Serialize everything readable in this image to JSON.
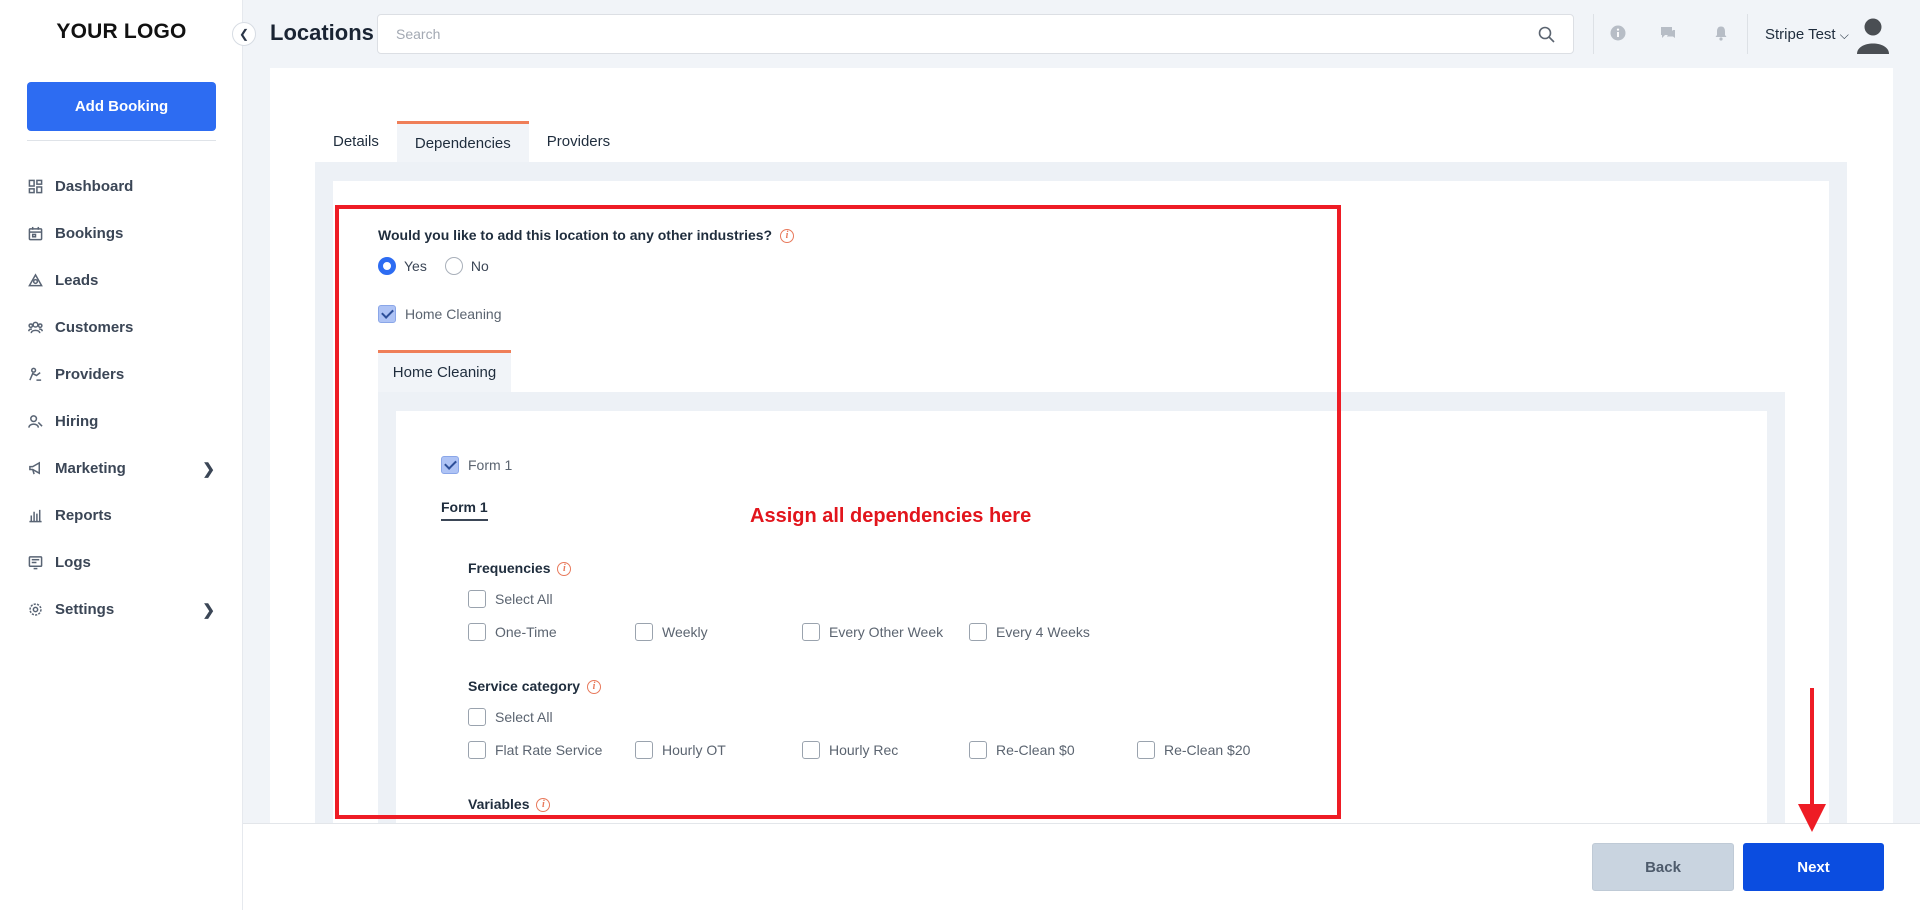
{
  "logo": "YOUR LOGO",
  "sidebar": {
    "add_button": "Add Booking",
    "items": [
      {
        "label": "Dashboard",
        "icon": "dashboard-icon"
      },
      {
        "label": "Bookings",
        "icon": "calendar-icon"
      },
      {
        "label": "Leads",
        "icon": "leads-icon"
      },
      {
        "label": "Customers",
        "icon": "customers-icon"
      },
      {
        "label": "Providers",
        "icon": "providers-icon"
      },
      {
        "label": "Hiring",
        "icon": "hiring-icon"
      },
      {
        "label": "Marketing",
        "icon": "megaphone-icon",
        "expandable": true
      },
      {
        "label": "Reports",
        "icon": "bar-chart-icon"
      },
      {
        "label": "Logs",
        "icon": "logs-icon"
      },
      {
        "label": "Settings",
        "icon": "gear-icon",
        "expandable": true
      }
    ]
  },
  "header": {
    "title": "Locations",
    "search_placeholder": "Search",
    "user_name": "Stripe Test"
  },
  "tabs": [
    "Details",
    "Dependencies",
    "Providers"
  ],
  "active_tab": "Dependencies",
  "dependencies": {
    "question": "Would you like to add this location to any other industries?",
    "yes_label": "Yes",
    "no_label": "No",
    "selected": "Yes",
    "industry_checkbox": "Home Cleaning",
    "industry_checked": true,
    "industry_tab": "Home Cleaning",
    "form_checkbox": "Form 1",
    "form_checked": true,
    "form_link": "Form 1",
    "frequencies": {
      "title": "Frequencies",
      "select_all": "Select All",
      "options": [
        "One-Time",
        "Weekly",
        "Every Other Week",
        "Every 4 Weeks"
      ]
    },
    "service_category": {
      "title": "Service category",
      "select_all": "Select All",
      "options": [
        "Flat Rate Service",
        "Hourly OT",
        "Hourly Rec",
        "Re-Clean $0",
        "Re-Clean $20"
      ]
    },
    "variables": {
      "title": "Variables"
    }
  },
  "annotation": {
    "text": "Assign all dependencies here",
    "color": "#ee1c25"
  },
  "footer": {
    "back": "Back",
    "next": "Next"
  },
  "colors": {
    "primary": "#2d6cf2",
    "next_button": "#0b4de0",
    "accent": "#ef7e58"
  }
}
